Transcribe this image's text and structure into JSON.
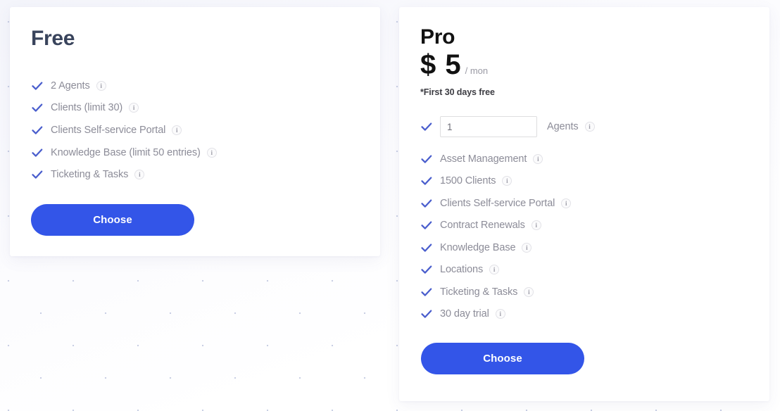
{
  "plans": [
    {
      "id": "free",
      "title": "Free",
      "features": [
        {
          "label": "2 Agents",
          "info": "info-icon"
        },
        {
          "label": "Clients (limit 30)",
          "info": "info-icon"
        },
        {
          "label": "Clients Self-service Portal",
          "info": "info-icon"
        },
        {
          "label": "Knowledge Base (limit 50 entries)",
          "info": "info-icon"
        },
        {
          "label": "Ticketing & Tasks",
          "info": "info-icon"
        }
      ],
      "cta_label": "Choose"
    },
    {
      "id": "pro",
      "title": "Pro",
      "price_amount": "$ 5",
      "price_period": "/ mon",
      "price_note": "*First 30 days free",
      "agents_value": "1",
      "agents_placeholder": "1",
      "agents_label": "Agents",
      "features": [
        {
          "label": "Asset Management",
          "info": "info-icon"
        },
        {
          "label": "1500 Clients",
          "info": "info-icon"
        },
        {
          "label": "Clients Self-service Portal",
          "info": "info-icon"
        },
        {
          "label": "Contract Renewals",
          "info": "info-icon"
        },
        {
          "label": "Knowledge Base",
          "info": "info-icon"
        },
        {
          "label": "Locations",
          "info": "info-icon"
        },
        {
          "label": "Ticketing & Tasks",
          "info": "info-icon"
        },
        {
          "label": "30 day trial",
          "info": "info-icon"
        }
      ],
      "cta_label": "Choose"
    }
  ],
  "icons": {
    "info_glyph": "i",
    "check": "check-icon"
  },
  "colors": {
    "accent_button": "#3355e8",
    "check_mark": "#4a5ecd",
    "feature_text": "#8c8c98",
    "free_title": "#39445c",
    "pro_title": "#121212",
    "card_background": "#ffffff",
    "page_background": "#fdfdff",
    "dot_pattern": "#c9cfe4"
  }
}
